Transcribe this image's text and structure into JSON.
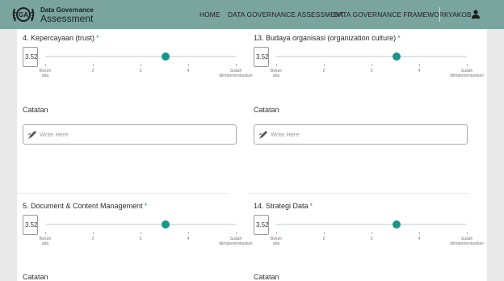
{
  "header": {
    "logo_line1": "Data Governance",
    "logo_line2": "Assessment",
    "nav": [
      "HOME",
      "DATA GOVERNANCE ASSESSMENT",
      "DATA GOVERNANCE FRAMEWORK"
    ],
    "user_name": "YAKOB"
  },
  "questions": [
    {
      "title": "4. Kepercayaan (trust)",
      "required": "*",
      "value": "3.52",
      "level": 3.52
    },
    {
      "title": "13. Budaya organisasi (organization culture)",
      "required": "*",
      "value": "3.52",
      "level": 3.52
    },
    {
      "title": "5. Document & Content Management",
      "required": "*",
      "value": "3.52",
      "level": 3.52
    },
    {
      "title": "14. Strategi Data",
      "required": "*",
      "value": "3.52",
      "level": 3.52
    }
  ],
  "scale": {
    "min": 1,
    "max": 5,
    "tick_labels": [
      [
        "Belum",
        "ada"
      ],
      [
        "2",
        ""
      ],
      [
        "3",
        ""
      ],
      [
        "4",
        ""
      ],
      [
        "Sudah",
        "diimplementasikan"
      ]
    ]
  },
  "notes": {
    "label": "Catatan",
    "placeholder": "Write Here"
  },
  "colors": {
    "navbar": "#7aa59f",
    "accent": "#16958a",
    "required": "#1c9a8a"
  }
}
